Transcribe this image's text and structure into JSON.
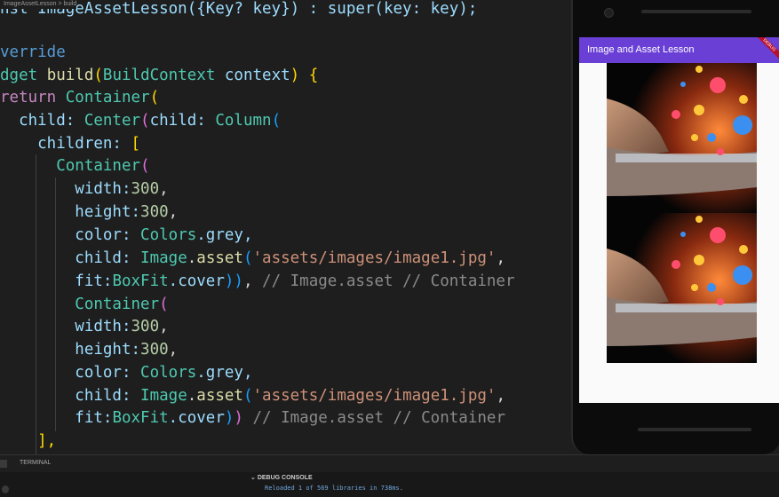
{
  "breadcrumb": "ImageAssetLesson > build",
  "editor": {
    "lines": [
      [
        {
          "t": "nst ImageAssetLesson({Key? key}) : super(key: key);",
          "c": "prop"
        }
      ],
      [
        {
          "t": "verride",
          "c": "kw"
        }
      ],
      [
        {
          "t": "dget ",
          "c": "cls"
        },
        {
          "t": "build",
          "c": "fn"
        },
        {
          "t": "(",
          "c": "br1"
        },
        {
          "t": "BuildContext ",
          "c": "cls"
        },
        {
          "t": "context",
          "c": "prop"
        },
        {
          "t": ") {",
          "c": "br1"
        }
      ],
      [
        {
          "t": "return ",
          "c": "kwc"
        },
        {
          "t": "Container",
          "c": "cls"
        },
        {
          "t": "(",
          "c": "br1"
        }
      ],
      [
        {
          "t": "  child: ",
          "c": "prop"
        },
        {
          "t": "Center",
          "c": "cls"
        },
        {
          "t": "(",
          "c": "br2"
        },
        {
          "t": "child: ",
          "c": "prop"
        },
        {
          "t": "Column",
          "c": "cls"
        },
        {
          "t": "(",
          "c": "br3"
        }
      ],
      [
        {
          "t": "    children: ",
          "c": "prop"
        },
        {
          "t": "[",
          "c": "br1"
        }
      ],
      [
        {
          "t": "      Container",
          "c": "cls"
        },
        {
          "t": "(",
          "c": "br2"
        }
      ],
      [
        {
          "t": "        width:",
          "c": "prop"
        },
        {
          "t": "300",
          "c": "num"
        },
        {
          "t": ",",
          "c": ""
        }
      ],
      [
        {
          "t": "        height:",
          "c": "prop"
        },
        {
          "t": "300",
          "c": "num"
        },
        {
          "t": ",",
          "c": ""
        }
      ],
      [
        {
          "t": "        color: ",
          "c": "prop"
        },
        {
          "t": "Colors",
          "c": "cls"
        },
        {
          "t": ".grey,",
          "c": "prop"
        }
      ],
      [
        {
          "t": "        child: ",
          "c": "prop"
        },
        {
          "t": "Image",
          "c": "cls"
        },
        {
          "t": ".",
          "c": ""
        },
        {
          "t": "asset",
          "c": "fn"
        },
        {
          "t": "(",
          "c": "br3"
        },
        {
          "t": "'assets/images/image1.jpg'",
          "c": "str"
        },
        {
          "t": ",",
          "c": ""
        }
      ],
      [
        {
          "t": "        fit:",
          "c": "prop"
        },
        {
          "t": "BoxFit",
          "c": "cls"
        },
        {
          "t": ".cover",
          "c": "prop"
        },
        {
          "t": "))",
          "c": "br3"
        },
        {
          "t": ", ",
          "c": ""
        },
        {
          "t": "// Image.asset // Container",
          "c": "cm"
        }
      ],
      [
        {
          "t": "        Container",
          "c": "cls"
        },
        {
          "t": "(",
          "c": "br2"
        }
      ],
      [
        {
          "t": "        width:",
          "c": "prop"
        },
        {
          "t": "300",
          "c": "num"
        },
        {
          "t": ",",
          "c": ""
        }
      ],
      [
        {
          "t": "        height:",
          "c": "prop"
        },
        {
          "t": "300",
          "c": "num"
        },
        {
          "t": ",",
          "c": ""
        }
      ],
      [
        {
          "t": "        color: ",
          "c": "prop"
        },
        {
          "t": "Colors",
          "c": "cls"
        },
        {
          "t": ".grey,",
          "c": "prop"
        }
      ],
      [
        {
          "t": "        child: ",
          "c": "prop"
        },
        {
          "t": "Image",
          "c": "cls"
        },
        {
          "t": ".",
          "c": ""
        },
        {
          "t": "asset",
          "c": "fn"
        },
        {
          "t": "(",
          "c": "br3"
        },
        {
          "t": "'assets/images/image1.jpg'",
          "c": "str"
        },
        {
          "t": ",",
          "c": ""
        }
      ],
      [
        {
          "t": "        fit:",
          "c": "prop"
        },
        {
          "t": "BoxFit",
          "c": "cls"
        },
        {
          "t": ".cover",
          "c": "prop"
        },
        {
          "t": ")",
          "c": "br3"
        },
        {
          "t": ")",
          "c": "br2"
        },
        {
          "t": " // Image.asset // Container",
          "c": "cm"
        }
      ],
      [
        {
          "t": "    ],",
          "c": "br1"
        }
      ]
    ]
  },
  "panel": {
    "tab_terminal": "TERMINAL",
    "debug_console": "DEBUG CONSOLE",
    "console_output": "Reloaded 1 of 569 libraries in 738ms."
  },
  "app": {
    "title": "Image and Asset Lesson",
    "debug_banner": "DEBUG",
    "accent": "#6a3fd6"
  }
}
